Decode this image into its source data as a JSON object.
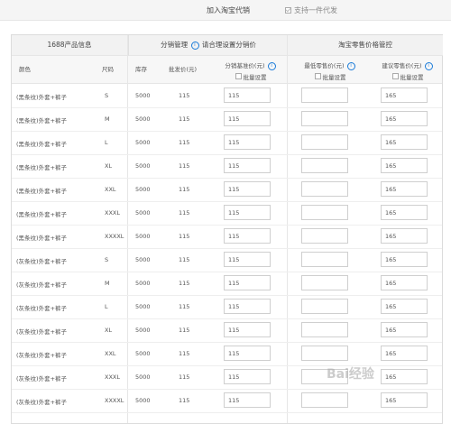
{
  "topbar": {
    "join_label": "加入淘宝代销",
    "one_ship_label": "支持一件代发"
  },
  "groups": {
    "product_info": "1688产品信息",
    "distribution": "分销管理",
    "distribution_hint": "请合理设置分销价",
    "retail": "淘宝零售价格管控"
  },
  "columns": {
    "color": "颜色",
    "size": "尺码",
    "stock": "库存",
    "wholesale": "批发价(元)",
    "dist_price": "分销基准价(元)",
    "min_retail": "最低零售价(元)",
    "suggest_retail": "建议零售价(元)",
    "bulk_set": "批量设置"
  },
  "rows": [
    {
      "color": "(黑条纹)外套+裤子",
      "size": "S",
      "stock": "5000",
      "wholesale": "115",
      "dist": "115",
      "min": "",
      "suggest": "165"
    },
    {
      "color": "(黑条纹)外套+裤子",
      "size": "M",
      "stock": "5000",
      "wholesale": "115",
      "dist": "115",
      "min": "",
      "suggest": "165"
    },
    {
      "color": "(黑条纹)外套+裤子",
      "size": "L",
      "stock": "5000",
      "wholesale": "115",
      "dist": "115",
      "min": "",
      "suggest": "165"
    },
    {
      "color": "(黑条纹)外套+裤子",
      "size": "XL",
      "stock": "5000",
      "wholesale": "115",
      "dist": "115",
      "min": "",
      "suggest": "165"
    },
    {
      "color": "(黑条纹)外套+裤子",
      "size": "XXL",
      "stock": "5000",
      "wholesale": "115",
      "dist": "115",
      "min": "",
      "suggest": "165"
    },
    {
      "color": "(黑条纹)外套+裤子",
      "size": "XXXL",
      "stock": "5000",
      "wholesale": "115",
      "dist": "115",
      "min": "",
      "suggest": "165"
    },
    {
      "color": "(黑条纹)外套+裤子",
      "size": "XXXXL",
      "stock": "5000",
      "wholesale": "115",
      "dist": "115",
      "min": "",
      "suggest": "165"
    },
    {
      "color": "(灰条纹)外套+裤子",
      "size": "S",
      "stock": "5000",
      "wholesale": "115",
      "dist": "115",
      "min": "",
      "suggest": "165"
    },
    {
      "color": "(灰条纹)外套+裤子",
      "size": "M",
      "stock": "5000",
      "wholesale": "115",
      "dist": "115",
      "min": "",
      "suggest": "165"
    },
    {
      "color": "(灰条纹)外套+裤子",
      "size": "L",
      "stock": "5000",
      "wholesale": "115",
      "dist": "115",
      "min": "",
      "suggest": "165"
    },
    {
      "color": "(灰条纹)外套+裤子",
      "size": "XL",
      "stock": "5000",
      "wholesale": "115",
      "dist": "115",
      "min": "",
      "suggest": "165"
    },
    {
      "color": "(灰条纹)外套+裤子",
      "size": "XXL",
      "stock": "5000",
      "wholesale": "115",
      "dist": "115",
      "min": "",
      "suggest": "165"
    },
    {
      "color": "(灰条纹)外套+裤子",
      "size": "XXXL",
      "stock": "5000",
      "wholesale": "115",
      "dist": "115",
      "min": "",
      "suggest": "165"
    },
    {
      "color": "(灰条纹)外套+裤子",
      "size": "XXXXL",
      "stock": "5000",
      "wholesale": "115",
      "dist": "115",
      "min": "",
      "suggest": "165"
    }
  ],
  "watermark": "Bai经验"
}
